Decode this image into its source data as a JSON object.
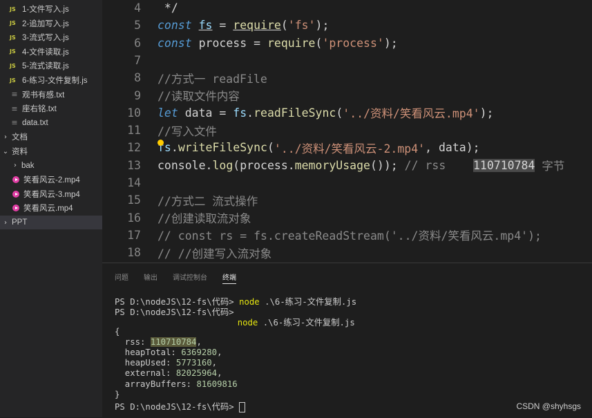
{
  "sidebar": {
    "items": [
      {
        "type": "js",
        "label": "1-文件写入.js"
      },
      {
        "type": "js",
        "label": "2-追加写入.js"
      },
      {
        "type": "js",
        "label": "3-流式写入.js"
      },
      {
        "type": "js",
        "label": "4-文件读取.js"
      },
      {
        "type": "js",
        "label": "5-流式读取.js"
      },
      {
        "type": "js",
        "label": "6-练习-文件复制.js"
      },
      {
        "type": "txt",
        "label": "观书有感.txt"
      },
      {
        "type": "txt",
        "label": "座右铭.txt"
      },
      {
        "type": "txt",
        "label": "data.txt"
      },
      {
        "type": "folder-closed",
        "label": "文档"
      },
      {
        "type": "folder-open",
        "label": "资料"
      },
      {
        "type": "folder-closed-sub",
        "label": "bak"
      },
      {
        "type": "mp4",
        "label": "笑看风云-2.mp4"
      },
      {
        "type": "mp4",
        "label": "笑看风云-3.mp4"
      },
      {
        "type": "mp4",
        "label": "笑看风云.mp4"
      },
      {
        "type": "folder-closed",
        "label": "PPT"
      }
    ],
    "js_badge": "JS",
    "txt_glyph": "≡",
    "chev_closed": "›",
    "chev_open": "⌄"
  },
  "editor": {
    "lines": [
      {
        "n": "4",
        "parts": [
          [
            "plain",
            " */"
          ]
        ]
      },
      {
        "n": "5",
        "parts": [
          [
            "kw",
            "const"
          ],
          [
            "plain",
            " "
          ],
          [
            "var ul",
            "fs"
          ],
          [
            "plain",
            " = "
          ],
          [
            "fn ul",
            "require"
          ],
          [
            "plain",
            "("
          ],
          [
            "str",
            "'fs'"
          ],
          [
            "plain",
            ");"
          ]
        ]
      },
      {
        "n": "6",
        "parts": [
          [
            "kw",
            "const"
          ],
          [
            "plain",
            " process = "
          ],
          [
            "fn",
            "require"
          ],
          [
            "plain",
            "("
          ],
          [
            "str",
            "'process'"
          ],
          [
            "plain",
            ");"
          ]
        ]
      },
      {
        "n": "7",
        "parts": []
      },
      {
        "n": "8",
        "parts": [
          [
            "cm-dim",
            "//方式一 readFile"
          ]
        ]
      },
      {
        "n": "9",
        "parts": [
          [
            "cm-dim",
            "//读取文件内容"
          ]
        ]
      },
      {
        "n": "10",
        "parts": [
          [
            "kw",
            "let"
          ],
          [
            "plain",
            " data = "
          ],
          [
            "var",
            "fs"
          ],
          [
            "plain",
            "."
          ],
          [
            "fn",
            "readFileSync"
          ],
          [
            "plain",
            "("
          ],
          [
            "str",
            "'../资料/笑看风云.mp4'"
          ],
          [
            "plain",
            ");"
          ]
        ]
      },
      {
        "n": "11",
        "parts": [
          [
            "cm-dim",
            "//写入文件"
          ]
        ]
      },
      {
        "n": "12",
        "parts": [
          [
            "var",
            "fs"
          ],
          [
            "plain",
            "."
          ],
          [
            "fn",
            "writeFileSync"
          ],
          [
            "plain",
            "("
          ],
          [
            "str",
            "'../资料/笑看风云-2.mp4'"
          ],
          [
            "plain",
            ", data);"
          ]
        ]
      },
      {
        "n": "13",
        "parts": [
          [
            "plain",
            "console."
          ],
          [
            "fn",
            "log"
          ],
          [
            "plain",
            "(process."
          ],
          [
            "fn",
            "memoryUsage"
          ],
          [
            "plain",
            "()); "
          ],
          [
            "cm-dim",
            "// rss    "
          ],
          [
            "sel",
            "110710784"
          ],
          [
            "cm-dim",
            " 字节"
          ]
        ]
      },
      {
        "n": "14",
        "parts": []
      },
      {
        "n": "15",
        "parts": [
          [
            "cm-dim",
            "//方式二 流式操作"
          ]
        ]
      },
      {
        "n": "16",
        "parts": [
          [
            "cm-dim",
            "//创建读取流对象"
          ]
        ]
      },
      {
        "n": "17",
        "parts": [
          [
            "cm-dim",
            "// const rs = fs.createReadStream('../资料/笑看风云.mp4');"
          ]
        ]
      },
      {
        "n": "18",
        "parts": [
          [
            "cm-dim",
            "// //创建写入流对象"
          ]
        ]
      }
    ]
  },
  "panel": {
    "tabs": [
      "问题",
      "输出",
      "调试控制台",
      "终端"
    ],
    "active_tab": 3
  },
  "terminal": {
    "prompt": "PS D:\\nodeJS\\12-fs\\代码> ",
    "cmd_word": "node",
    "cmd_arg": " .\\6-练习-文件复制.js",
    "indent_pad": "                        ",
    "open_brace": "{",
    "close_brace": "}",
    "rss_label": "  rss: ",
    "rss": "110710784",
    "heapTotal_label": "  heapTotal: ",
    "heapTotal": "6369280",
    "heapUsed_label": "  heapUsed: ",
    "heapUsed": "5773160",
    "external_label": "  external: ",
    "external": "82025964",
    "arrayBuffers_label": "  arrayBuffers: ",
    "arrayBuffers": "81609816",
    "comma": ","
  },
  "watermark": "CSDN @shyhsgs",
  "colors": {
    "js_badge": "#cbcb41",
    "mp4": "#e03ea4",
    "keyword": "#569cd6",
    "function": "#dcdcaa",
    "string": "#ce9178"
  }
}
